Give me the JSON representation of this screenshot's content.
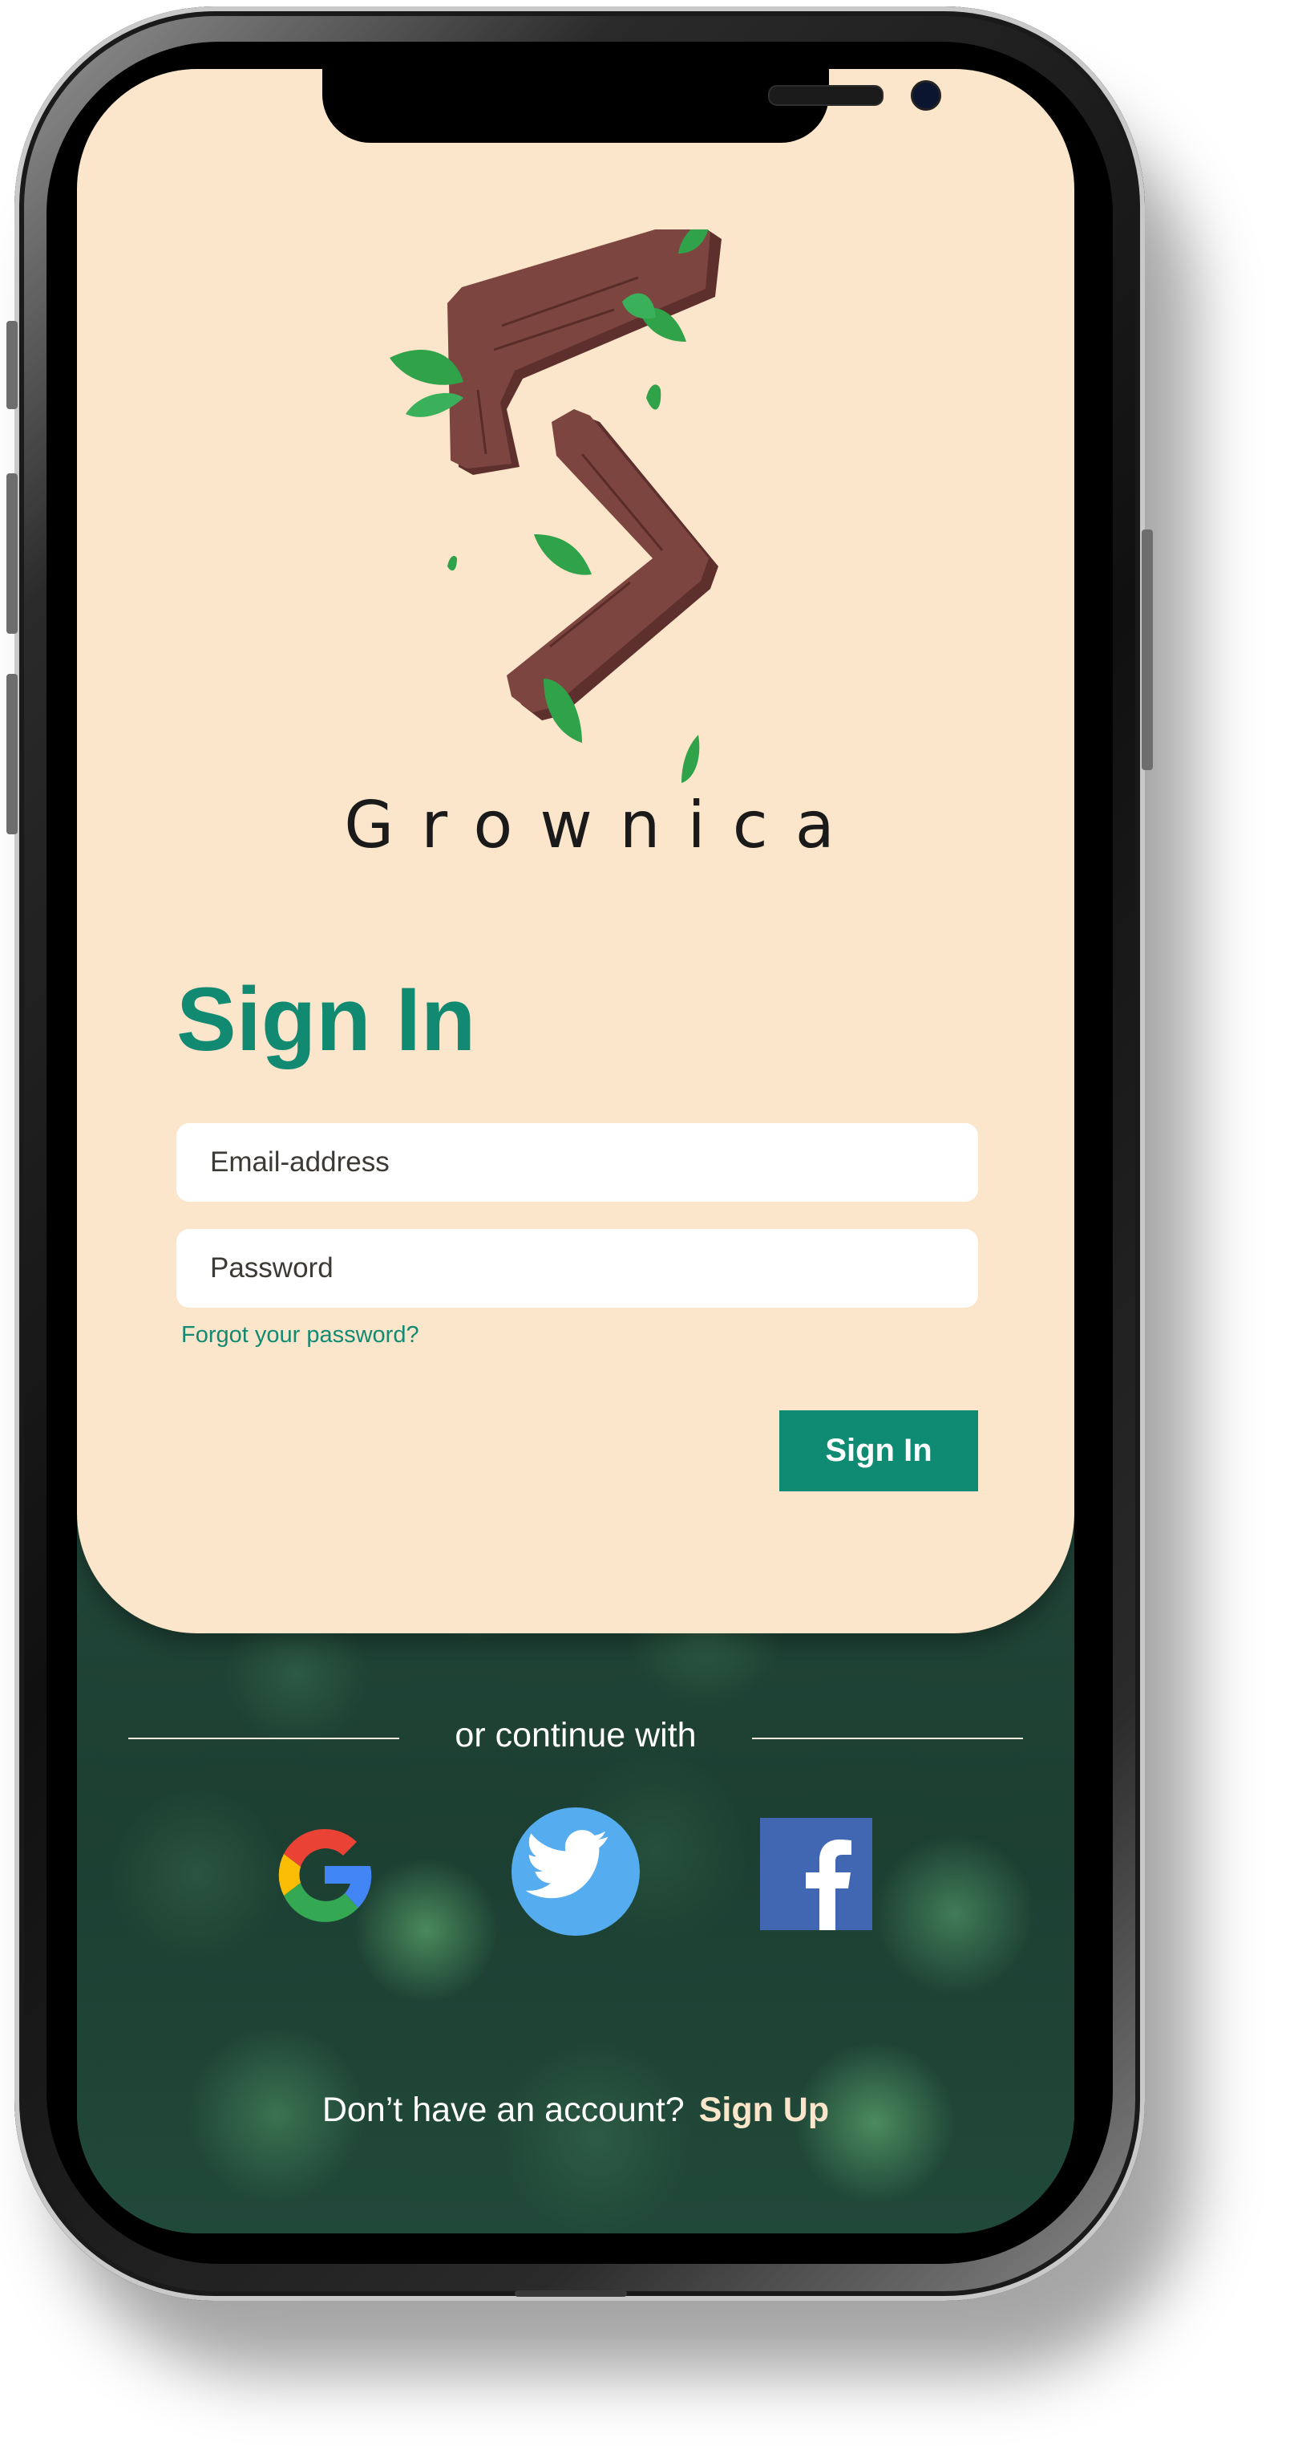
{
  "app": {
    "brand_name": "Grownica"
  },
  "signin": {
    "title": "Sign In",
    "email_placeholder": "Email-address",
    "password_placeholder": "Password",
    "forgot_link": "Forgot your password?",
    "submit_label": "Sign In"
  },
  "social": {
    "divider_text": "or continue with",
    "providers": [
      "google-icon",
      "twitter-icon",
      "facebook-icon"
    ]
  },
  "footer": {
    "prompt": "Don’t have an account?",
    "signup_label": "Sign Up"
  },
  "colors": {
    "card_background": "#fce6cb",
    "accent": "#128a72",
    "logo_wood": "#7d4540",
    "logo_leaf": "#2fa24a"
  }
}
